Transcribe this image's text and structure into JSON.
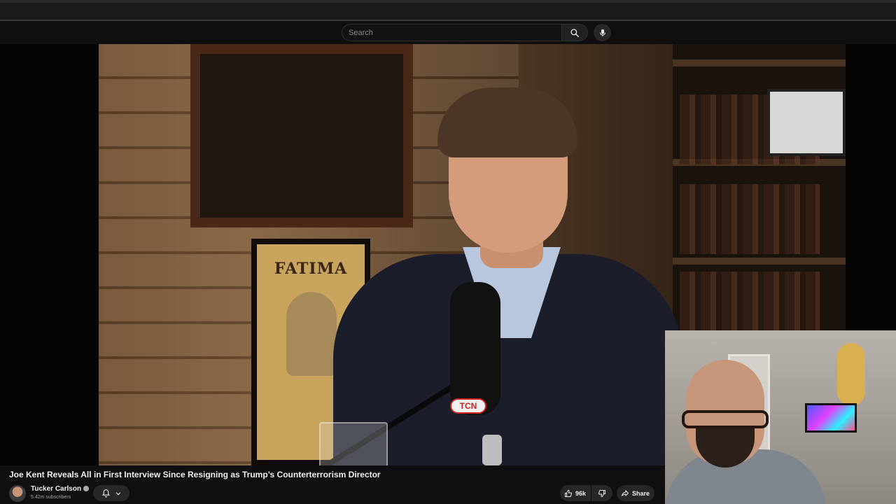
{
  "search": {
    "placeholder": "Search"
  },
  "video": {
    "title": "Joe Kent Reveals All in First Interview Since Resigning as Trump’s Counterterrorism Director",
    "poster_text": "FATIMA",
    "mic_badge_text": "TCN"
  },
  "channel": {
    "name": "Tucker Carlson",
    "subscribers": "5.42m subscribers"
  },
  "actions": {
    "like_count": "96k",
    "share_label": "Share"
  },
  "icons": {
    "search": "search-icon",
    "mic": "microphone-icon",
    "bell": "bell-icon",
    "chevron": "chevron-down-icon",
    "like": "thumbs-up-icon",
    "dislike": "thumbs-down-icon",
    "share": "share-arrow-icon",
    "verified": "verified-icon"
  },
  "colors": {
    "background": "#0f0f0f",
    "button": "#272727",
    "text": "#f1f1f1",
    "muted": "#aaaaaa"
  }
}
